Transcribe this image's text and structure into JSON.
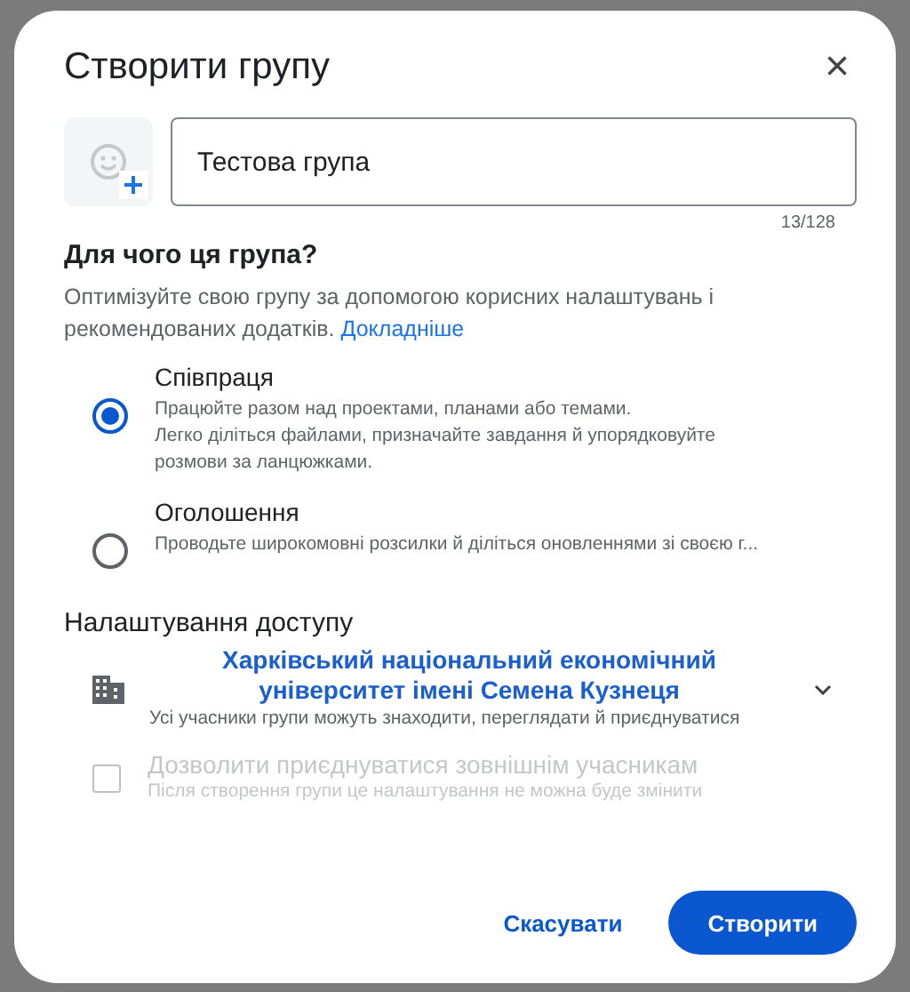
{
  "dialog": {
    "title": "Створити групу",
    "close": "×"
  },
  "name_field": {
    "value": "Тестова група",
    "counter": "13/128"
  },
  "purpose": {
    "heading": "Для чого ця група?",
    "description": "Оптимізуйте свою групу за допомогою корисних налаштувань і рекомендованих додатків.",
    "link": "Докладніше"
  },
  "options": [
    {
      "label": "Співпраця",
      "description": [
        "Працюйте разом над проектами, планами або темами.",
        "Легко діліться файлами, призначайте завдання й упорядковуйте розмови за ланцюжками."
      ],
      "selected": true
    },
    {
      "label": "Оголошення",
      "description": [
        "Проводьте широкомовні розсилки й діліться оновленнями зі своєю г..."
      ],
      "selected": false
    }
  ],
  "access": {
    "heading": "Налаштування доступу",
    "organization": "Харківський національний економічний університет імені Семена Кузнеця",
    "description": "Усі учасники групи можуть знаходити, переглядати й приєднуватися"
  },
  "external": {
    "label": "Дозволити приєднуватися зовнішнім учасникам",
    "description": "Після створення групи це налаштування не можна буде змінити",
    "checked": false,
    "disabled": true
  },
  "buttons": [
    {
      "label": "Скасувати",
      "kind": "text"
    },
    {
      "label": "Створити",
      "kind": "filled"
    }
  ]
}
